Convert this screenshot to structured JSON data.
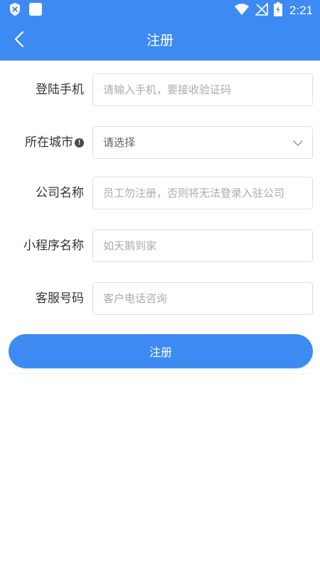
{
  "status_bar": {
    "time": "2:21",
    "icons": [
      "shield-x-icon",
      "app-square-icon",
      "wifi-icon",
      "signal-icon",
      "battery-charging-icon"
    ]
  },
  "header": {
    "title": "注册",
    "back_icon": "chevron-left-icon"
  },
  "form": {
    "phone": {
      "label": "登陆手机",
      "placeholder": "请输入手机，要接收验证码",
      "value": ""
    },
    "city": {
      "label": "所在城市",
      "selected": "请选择",
      "info_icon": "exclamation-circle-icon",
      "dropdown_icon": "chevron-down-icon"
    },
    "company": {
      "label": "公司名称",
      "placeholder": "员工勿注册，否则将无法登录入驻公司",
      "value": ""
    },
    "miniprogram": {
      "label": "小程序名称",
      "placeholder": "如天鹅到家",
      "value": ""
    },
    "service_phone": {
      "label": "客服号码",
      "placeholder": "客户电话咨询",
      "value": ""
    }
  },
  "submit_label": "注册",
  "colors": {
    "primary": "#3d8bf2",
    "border": "#dcdfe6",
    "placeholder": "#a8abb2",
    "label": "#333333"
  }
}
